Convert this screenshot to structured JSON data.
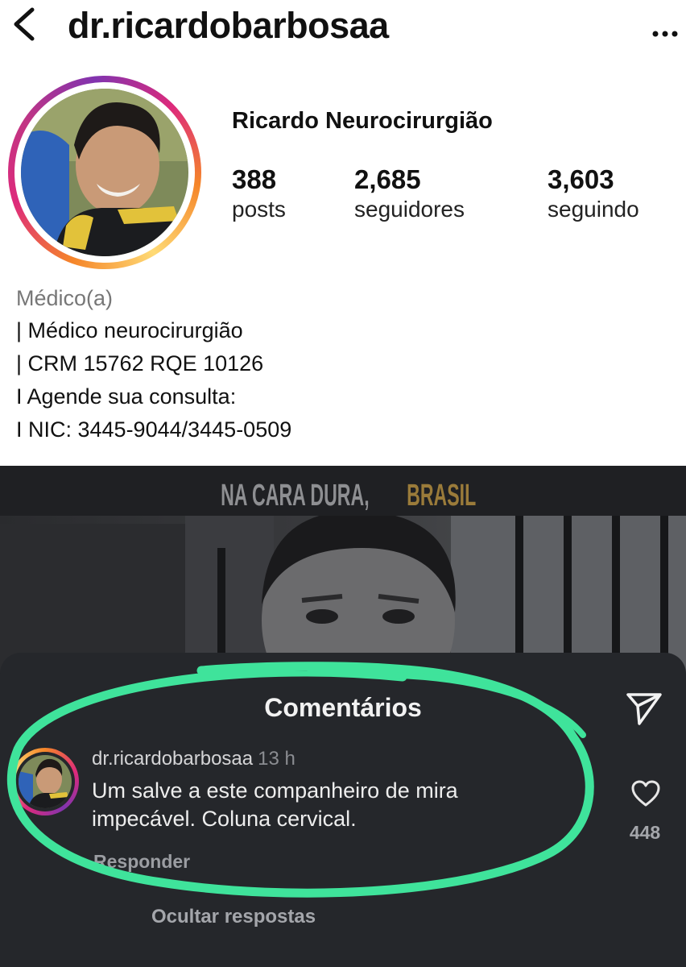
{
  "header": {
    "username": "dr.ricardobarbosaa",
    "back_icon": "chevron-left-icon",
    "more_icon": "ellipsis-icon"
  },
  "profile": {
    "display_name": "Ricardo Neurocirurgião",
    "stats": [
      {
        "value": "388",
        "label": "posts"
      },
      {
        "value": "2,685",
        "label": "seguidores"
      },
      {
        "value": "3,603",
        "label": "seguindo"
      }
    ],
    "bio": {
      "category": "Médico(a)",
      "lines": [
        "| Médico neurocirurgião",
        "| CRM 15762 RQE 10126",
        "I Agende sua consulta:",
        "I NIC: 3445-9044/3445-0509"
      ]
    }
  },
  "video": {
    "title_part1": "NA CARA DURA,",
    "title_part2": "BRASIL",
    "title_colors": {
      "part1": "#8e8f92",
      "part2": "#9a7b3a"
    }
  },
  "comments": {
    "title": "Comentários",
    "send_icon": "send-icon",
    "items": [
      {
        "user": "dr.ricardobarbosaa",
        "time": "13 h",
        "text_line1": "Um salve a este companheiro de mira",
        "text_line2": "impecável. Coluna cervical.",
        "reply_label": "Responder",
        "likes": "448",
        "heart_icon": "heart-outline-icon"
      }
    ],
    "hide_replies": "Ocultar respostas"
  },
  "colors": {
    "highlight_marker": "#3fe39b",
    "sheet_bg": "#25272b"
  }
}
